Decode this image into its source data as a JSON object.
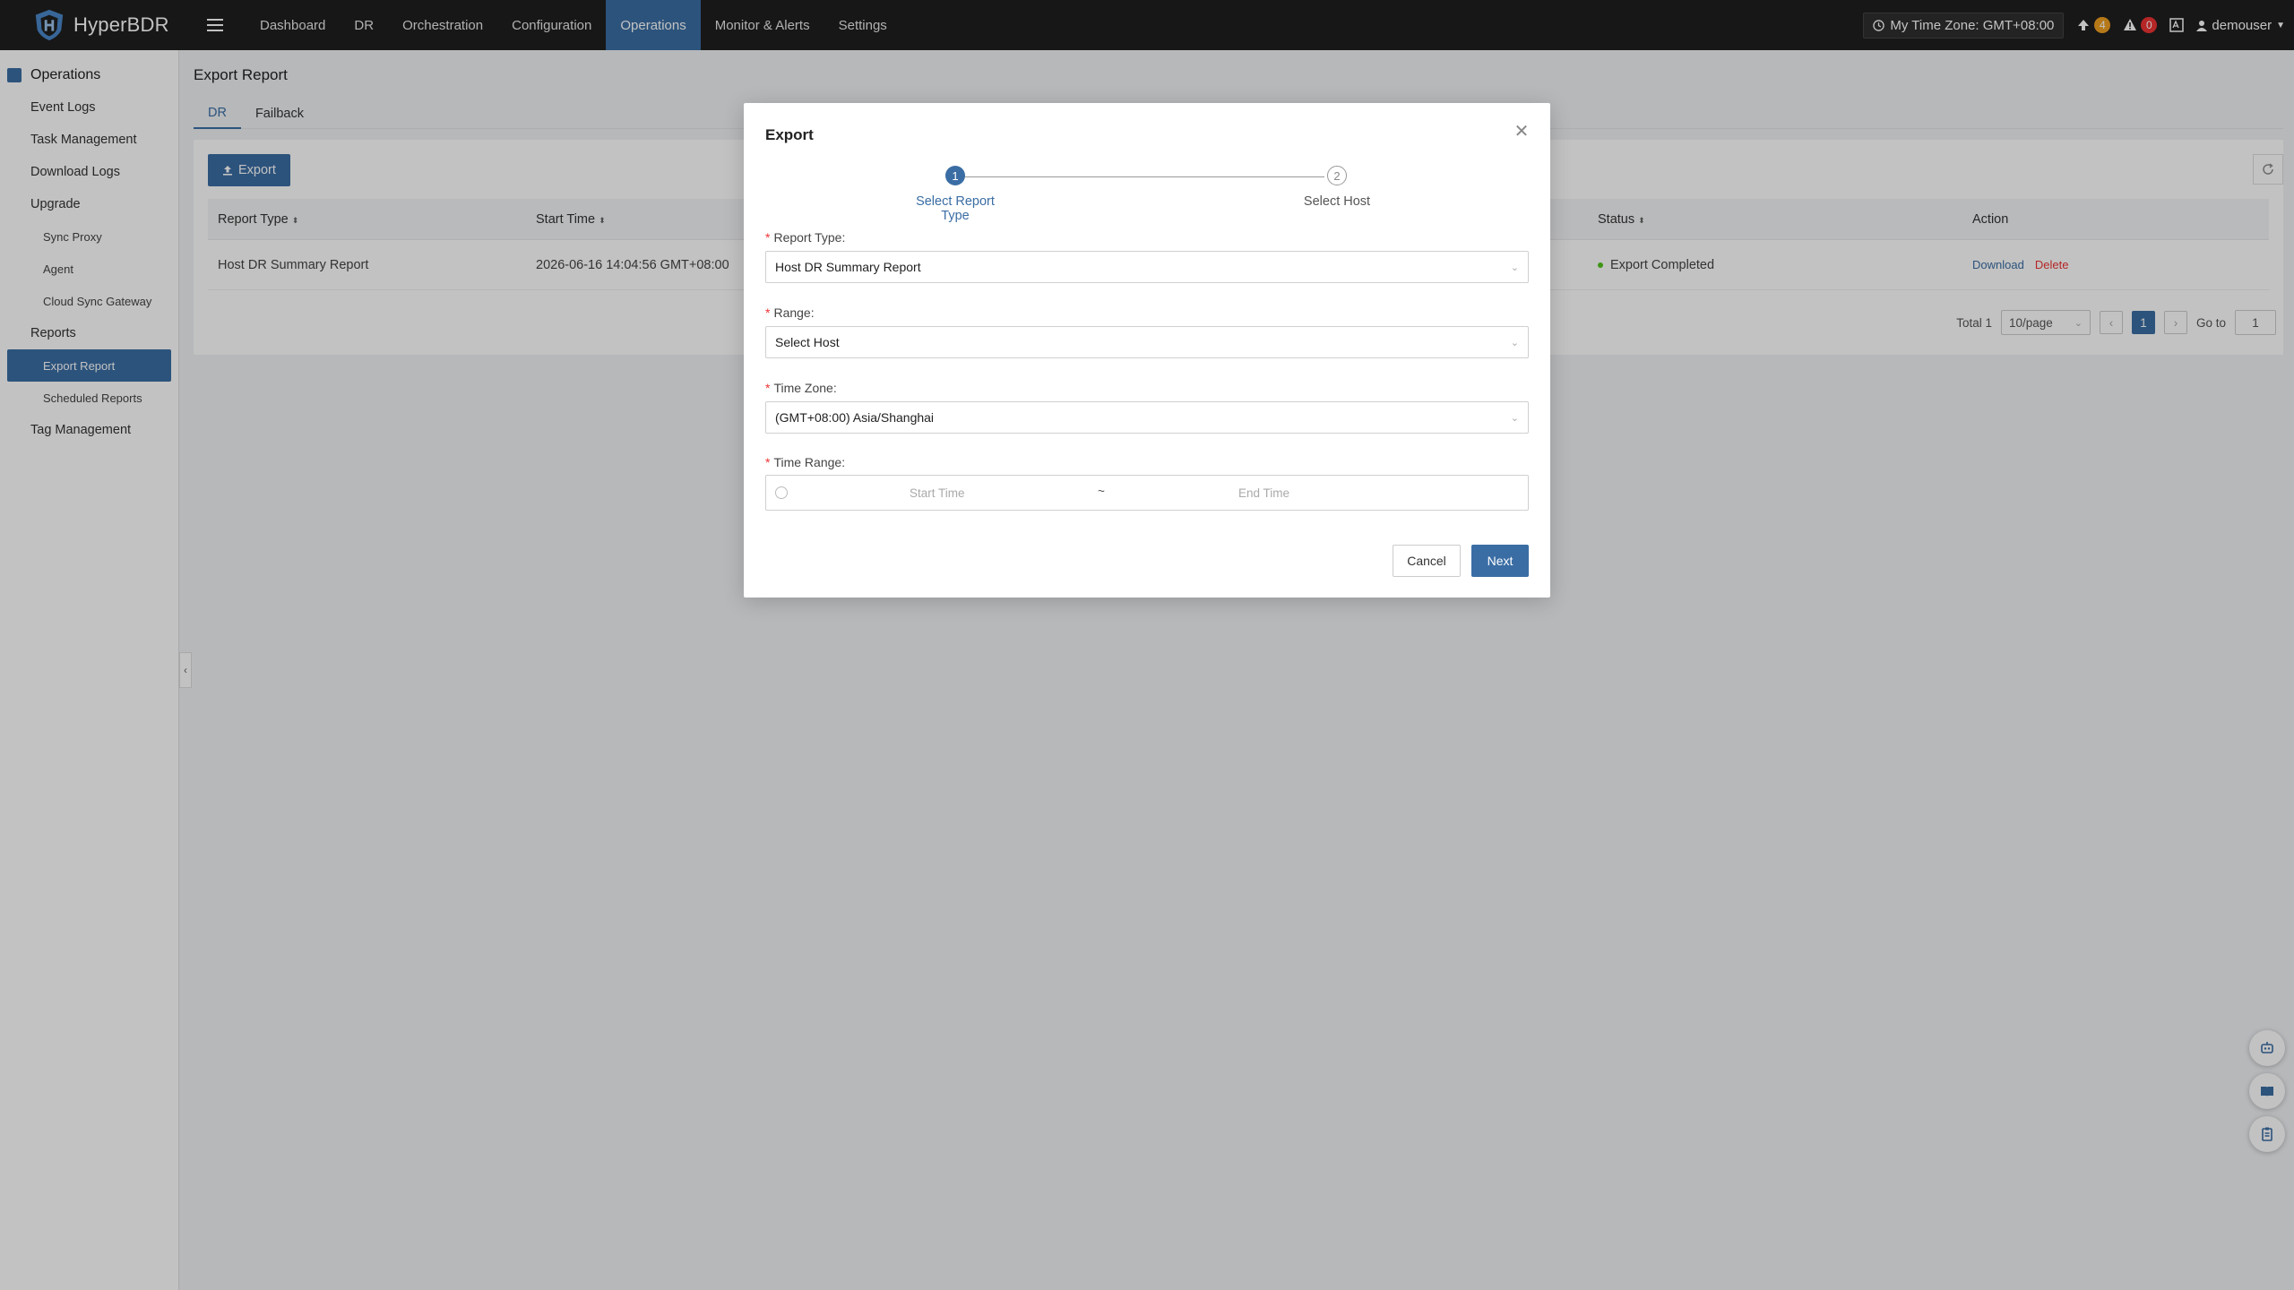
{
  "app": {
    "name": "HyperBDR"
  },
  "nav": {
    "items": [
      {
        "label": "Dashboard",
        "active": false
      },
      {
        "label": "DR",
        "active": false
      },
      {
        "label": "Orchestration",
        "active": false
      },
      {
        "label": "Configuration",
        "active": false
      },
      {
        "label": "Operations",
        "active": true
      },
      {
        "label": "Monitor & Alerts",
        "active": false
      },
      {
        "label": "Settings",
        "active": false
      }
    ]
  },
  "topbar": {
    "timezone_label": "My Time Zone: GMT+08:00",
    "upgrade_count": "4",
    "alert_count": "0",
    "username": "demouser"
  },
  "sidebar": {
    "title": "Operations",
    "items": [
      {
        "label": "Event Logs"
      },
      {
        "label": "Task Management"
      },
      {
        "label": "Download Logs"
      },
      {
        "label": "Upgrade"
      }
    ],
    "upgrade_sub": [
      {
        "label": "Sync Proxy"
      },
      {
        "label": "Agent"
      },
      {
        "label": "Cloud Sync Gateway"
      }
    ],
    "reports_label": "Reports",
    "reports_sub": [
      {
        "label": "Export Report",
        "active": true
      },
      {
        "label": "Scheduled Reports",
        "active": false
      }
    ],
    "tag_label": "Tag Management"
  },
  "page": {
    "title": "Export Report",
    "tabs": [
      {
        "label": "DR",
        "active": true
      },
      {
        "label": "Failback",
        "active": false
      }
    ],
    "export_button": "Export"
  },
  "table": {
    "headers": [
      "Report Type",
      "Start Time",
      "Status",
      "Action"
    ],
    "rows": [
      {
        "report_type": "Host DR Summary Report",
        "start_time": "2026-06-16 14:04:56 GMT+08:00",
        "status": "Export Completed",
        "actions": [
          "Download",
          "Delete"
        ]
      }
    ]
  },
  "pagination": {
    "total": "Total 1",
    "page_size": "10/page",
    "current_page": "1",
    "goto_label": "Go to",
    "goto_value": "1"
  },
  "modal": {
    "title": "Export",
    "steps": [
      {
        "number": "1",
        "label": "Select Report Type",
        "active": true
      },
      {
        "number": "2",
        "label": "Select Host",
        "active": false
      }
    ],
    "fields": {
      "report_type": {
        "label": "Report Type:",
        "value": "Host DR Summary Report"
      },
      "range": {
        "label": "Range:",
        "value": "Select Host"
      },
      "time_zone": {
        "label": "Time Zone:",
        "value": "(GMT+08:00) Asia/Shanghai"
      },
      "time_range": {
        "label": "Time Range:",
        "start_placeholder": "Start Time",
        "separator": "~",
        "end_placeholder": "End Time"
      }
    },
    "cancel_label": "Cancel",
    "next_label": "Next"
  },
  "colors": {
    "primary": "#3a6da4",
    "topbar_bg": "#1f1f1f",
    "success": "#52c41a",
    "danger": "#ee3333",
    "warning": "#f0a020"
  }
}
